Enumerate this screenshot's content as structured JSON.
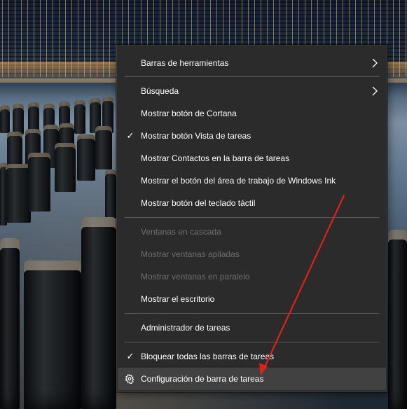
{
  "menu": {
    "items": [
      {
        "label": "Barras de herramientas",
        "submenu": true,
        "checked": false,
        "disabled": false
      },
      {
        "label": "Búsqueda",
        "submenu": true,
        "checked": false,
        "disabled": false
      },
      {
        "label": "Mostrar botón de Cortana",
        "submenu": false,
        "checked": false,
        "disabled": false
      },
      {
        "label": "Mostrar botón Vista de tareas",
        "submenu": false,
        "checked": true,
        "disabled": false
      },
      {
        "label": "Mostrar Contactos en la barra de tareas",
        "submenu": false,
        "checked": false,
        "disabled": false
      },
      {
        "label": "Mostrar el botón del área de trabajo de Windows Ink",
        "submenu": false,
        "checked": false,
        "disabled": false
      },
      {
        "label": "Mostrar botón del teclado táctil",
        "submenu": false,
        "checked": false,
        "disabled": false
      },
      {
        "label": "Ventanas en cascada",
        "submenu": false,
        "checked": false,
        "disabled": true
      },
      {
        "label": "Mostrar ventanas apiladas",
        "submenu": false,
        "checked": false,
        "disabled": true
      },
      {
        "label": "Mostrar ventanas en paralelo",
        "submenu": false,
        "checked": false,
        "disabled": true
      },
      {
        "label": "Mostrar el escritorio",
        "submenu": false,
        "checked": false,
        "disabled": false
      },
      {
        "label": "Administrador de tareas",
        "submenu": false,
        "checked": false,
        "disabled": false
      },
      {
        "label": "Bloquear todas las barras de tareas",
        "submenu": false,
        "checked": true,
        "disabled": false
      },
      {
        "label": "Configuración de barra de tareas",
        "submenu": false,
        "checked": false,
        "disabled": false,
        "icon": "gear-icon",
        "highlighted": true
      }
    ],
    "check_glyph": "✓"
  },
  "colors": {
    "menu_bg": "#2b2b2b",
    "menu_text": "#ffffff",
    "disabled_text": "#6e6e6e",
    "separator": "#5a5a5a",
    "hover_bg": "#414141",
    "annotation_arrow": "#e0201c"
  }
}
